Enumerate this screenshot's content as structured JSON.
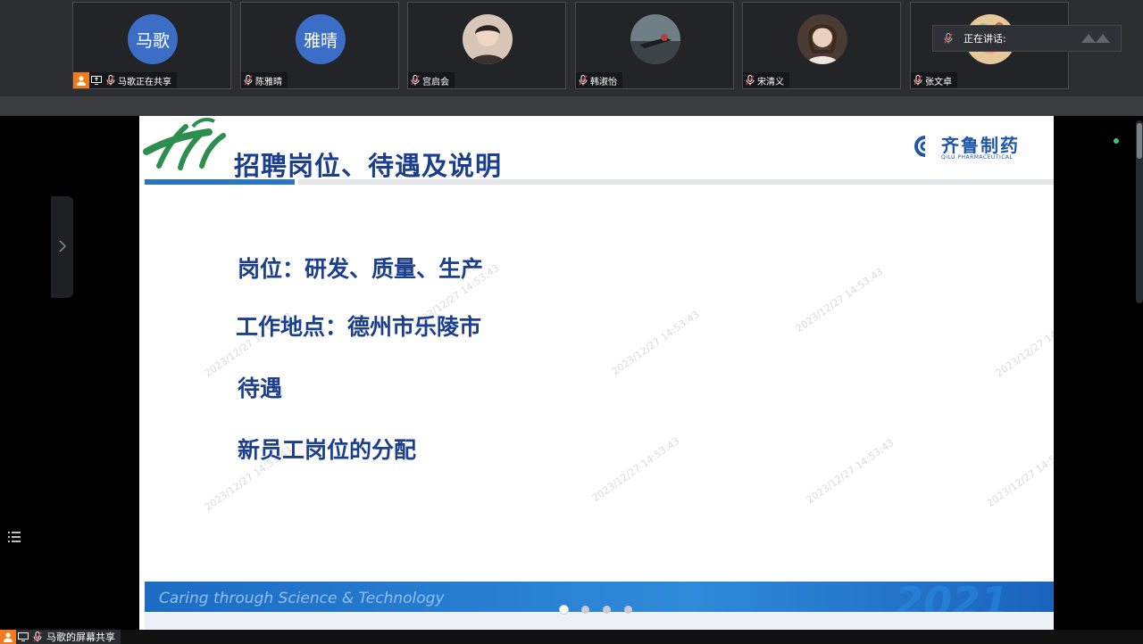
{
  "participants": [
    {
      "name": "马歌正在共享",
      "avatar_text": "马歌",
      "host": true,
      "sharing": true
    },
    {
      "name": "陈雅晴",
      "avatar_text": "雅晴"
    },
    {
      "name": "宫启会",
      "avatar_text": ""
    },
    {
      "name": "韩淑怡",
      "avatar_text": ""
    },
    {
      "name": "宋清义",
      "avatar_text": ""
    },
    {
      "name": "张文卓",
      "avatar_text": ""
    }
  ],
  "speaking": {
    "label": "正在讲话:"
  },
  "slide": {
    "title": "招聘岗位、待遇及说明",
    "brand_cn": "齐鲁制药",
    "brand_en": "QILU PHARMACEUTICAL",
    "bullets": [
      "岗位：研发、质量、生产",
      "工作地点：德州市乐陵市",
      "待遇",
      "新员工岗位的分配"
    ],
    "footer_slogan": "Caring through Science & Technology",
    "footer_year": "2021",
    "watermark": "2023/12/27 14:53:43"
  },
  "share_bar": {
    "label": "马歌的屏幕共享"
  },
  "colors": {
    "accent": "#3c6ec8",
    "host_badge": "#f07b1a",
    "slide_text": "#1b3f8c"
  }
}
